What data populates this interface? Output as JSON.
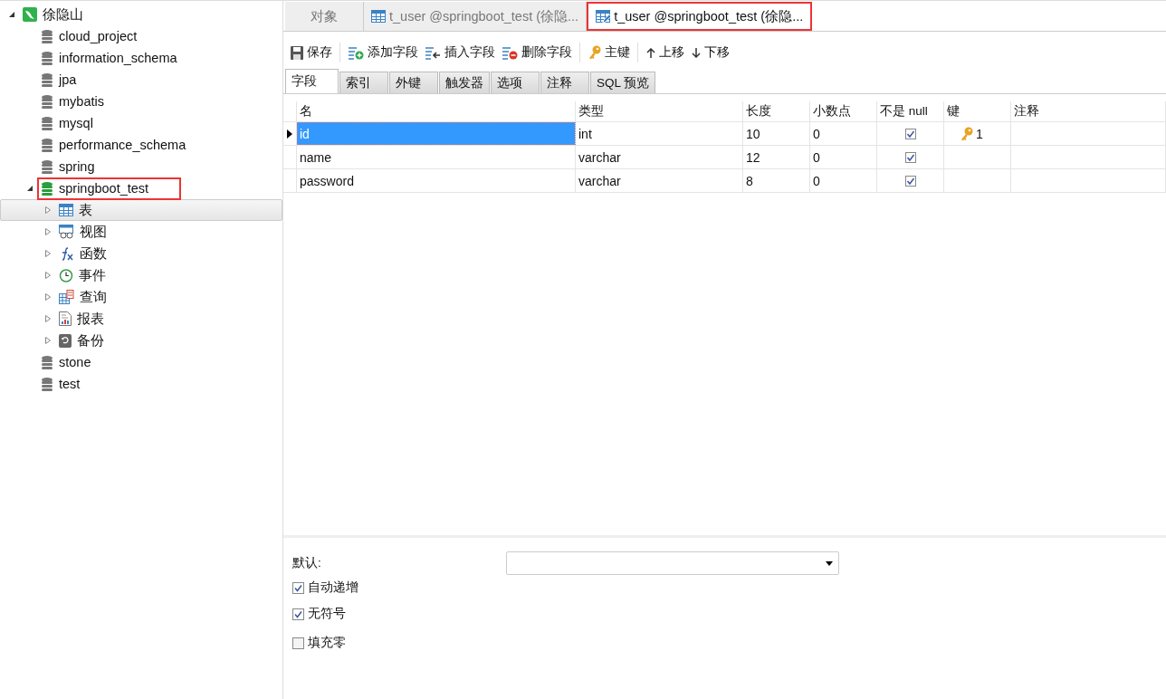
{
  "tree": [
    {
      "label": "徐隐山",
      "kind": "connection",
      "expanded": true,
      "selected": false,
      "marked": false,
      "children": [
        {
          "label": "cloud_project",
          "kind": "db",
          "selected": false,
          "marked": false
        },
        {
          "label": "information_schema",
          "kind": "db",
          "selected": false,
          "marked": false
        },
        {
          "label": "jpa",
          "kind": "db",
          "selected": false,
          "marked": false
        },
        {
          "label": "mybatis",
          "kind": "db",
          "selected": false,
          "marked": false
        },
        {
          "label": "mysql",
          "kind": "db",
          "selected": false,
          "marked": false
        },
        {
          "label": "performance_schema",
          "kind": "db",
          "selected": false,
          "marked": false
        },
        {
          "label": "spring",
          "kind": "db",
          "selected": false,
          "marked": false
        },
        {
          "label": "springboot_test",
          "kind": "db_open",
          "expanded": true,
          "selected": false,
          "marked": true,
          "children": [
            {
              "label": "表",
              "kind": "table",
              "expanded": false,
              "selected": true,
              "marked": false
            },
            {
              "label": "视图",
              "kind": "view",
              "expanded": false,
              "selected": false,
              "marked": false
            },
            {
              "label": "函数",
              "kind": "function",
              "expanded": false,
              "selected": false,
              "marked": false
            },
            {
              "label": "事件",
              "kind": "event",
              "expanded": false,
              "selected": false,
              "marked": false
            },
            {
              "label": "查询",
              "kind": "query",
              "expanded": false,
              "selected": false,
              "marked": false
            },
            {
              "label": "报表",
              "kind": "report",
              "expanded": false,
              "selected": false,
              "marked": false
            },
            {
              "label": "备份",
              "kind": "backup",
              "expanded": false,
              "selected": false,
              "marked": false
            }
          ]
        },
        {
          "label": "stone",
          "kind": "db",
          "selected": false,
          "marked": false
        },
        {
          "label": "test",
          "kind": "db",
          "selected": false,
          "marked": false
        }
      ]
    }
  ],
  "tabs": [
    {
      "label": "对象",
      "kind": "plain",
      "selected": false,
      "marked": false
    },
    {
      "label": "t_user @springboot_test (徐隐...",
      "kind": "table",
      "selected": false,
      "marked": false
    },
    {
      "label": "t_user @springboot_test (徐隐...",
      "kind": "design",
      "selected": true,
      "marked": true
    }
  ],
  "toolbar": [
    {
      "label": "保存",
      "kind": "save",
      "group_start": false
    },
    {
      "label": "添加字段",
      "kind": "add",
      "group_start": true
    },
    {
      "label": "插入字段",
      "kind": "insert",
      "group_start": false
    },
    {
      "label": "删除字段",
      "kind": "delete",
      "group_start": false
    },
    {
      "label": "主键",
      "kind": "key",
      "group_start": true
    },
    {
      "label": "上移",
      "kind": "up",
      "group_start": true
    },
    {
      "label": "下移",
      "kind": "down",
      "group_start": false
    }
  ],
  "subtabs": [
    {
      "label": "字段",
      "selected": true
    },
    {
      "label": "索引",
      "selected": false
    },
    {
      "label": "外键",
      "selected": false
    },
    {
      "label": "触发器",
      "selected": false
    },
    {
      "label": "选项",
      "selected": false
    },
    {
      "label": "注释",
      "selected": false
    },
    {
      "label": "SQL 预览",
      "selected": false
    }
  ],
  "table": {
    "columns": [
      "名",
      "类型",
      "长度",
      "小数点",
      "不是 null",
      "键",
      "注释"
    ],
    "rows": [
      {
        "name": "id",
        "type": "int",
        "length": "10",
        "decimals": "0",
        "not_null": true,
        "key": "1",
        "selected": true
      },
      {
        "name": "name",
        "type": "varchar",
        "length": "12",
        "decimals": "0",
        "not_null": true,
        "selected": false
      },
      {
        "name": "password",
        "type": "varchar",
        "length": "8",
        "decimals": "0",
        "not_null": true,
        "selected": false
      }
    ]
  },
  "properties": {
    "default_label": "默认:",
    "options": [
      {
        "label": "自动递增",
        "checked": true
      },
      {
        "label": "无符号",
        "checked": true
      },
      {
        "label": "填充零",
        "checked": false
      }
    ]
  }
}
